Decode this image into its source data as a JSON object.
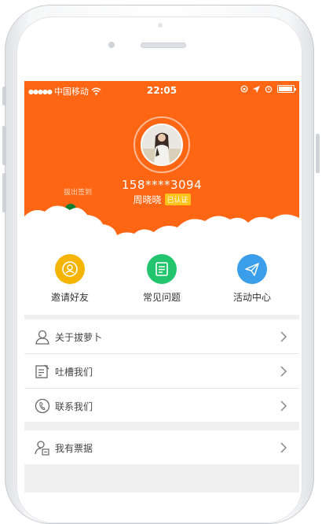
{
  "status_bar": {
    "signal": "●●●●●",
    "carrier": "中国移动",
    "time": "22:05"
  },
  "profile": {
    "phone": "158****3094",
    "name": "周晓晓",
    "verified_badge": "已认证",
    "signin_label": "拔出签到"
  },
  "quick_actions": [
    {
      "label": "邀请好友",
      "icon": "invite-icon",
      "color": "#f5b400"
    },
    {
      "label": "常见问题",
      "icon": "faq-icon",
      "color": "#22c46e"
    },
    {
      "label": "活动中心",
      "icon": "paper-plane-icon",
      "color": "#3a9eea"
    }
  ],
  "menu": {
    "items": [
      {
        "label": "关于拔萝卜",
        "icon": "user-icon"
      },
      {
        "label": "吐槽我们",
        "icon": "feedback-icon"
      },
      {
        "label": "联系我们",
        "icon": "phone-icon"
      },
      {
        "label": "我有票据",
        "icon": "ticket-user-icon"
      }
    ]
  },
  "colors": {
    "header_orange": "#ff6614",
    "badge_yellow": "#ffc21a"
  }
}
